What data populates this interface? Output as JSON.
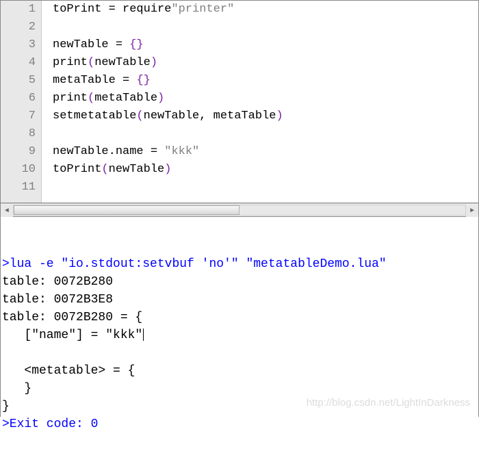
{
  "editor": {
    "lines": [
      {
        "n": "1",
        "tokens": [
          [
            "toPrint ",
            "ident"
          ],
          [
            "= ",
            "op"
          ],
          [
            "require",
            "func"
          ],
          [
            "\"printer\"",
            "string"
          ]
        ]
      },
      {
        "n": "2",
        "tokens": []
      },
      {
        "n": "3",
        "tokens": [
          [
            "newTable ",
            "ident"
          ],
          [
            "= ",
            "op"
          ],
          [
            "{}",
            "brace"
          ]
        ]
      },
      {
        "n": "4",
        "tokens": [
          [
            "print",
            "func"
          ],
          [
            "(",
            "brace"
          ],
          [
            "newTable",
            "ident"
          ],
          [
            ")",
            "brace"
          ]
        ]
      },
      {
        "n": "5",
        "tokens": [
          [
            "metaTable ",
            "ident"
          ],
          [
            "= ",
            "op"
          ],
          [
            "{}",
            "brace"
          ]
        ]
      },
      {
        "n": "6",
        "tokens": [
          [
            "print",
            "func"
          ],
          [
            "(",
            "brace"
          ],
          [
            "metaTable",
            "ident"
          ],
          [
            ")",
            "brace"
          ]
        ]
      },
      {
        "n": "7",
        "tokens": [
          [
            "setmetatable",
            "func"
          ],
          [
            "(",
            "brace"
          ],
          [
            "newTable",
            "ident"
          ],
          [
            ", ",
            "op"
          ],
          [
            "metaTable",
            "ident"
          ],
          [
            ")",
            "brace"
          ]
        ]
      },
      {
        "n": "8",
        "tokens": []
      },
      {
        "n": "9",
        "tokens": [
          [
            "newTable",
            "ident"
          ],
          [
            ".",
            "op"
          ],
          [
            "name ",
            "ident"
          ],
          [
            "= ",
            "op"
          ],
          [
            "\"kkk\"",
            "string"
          ]
        ]
      },
      {
        "n": "10",
        "tokens": [
          [
            "toPrint",
            "func"
          ],
          [
            "(",
            "brace"
          ],
          [
            "newTable",
            "ident"
          ],
          [
            ")",
            "brace"
          ]
        ]
      },
      {
        "n": "11",
        "tokens": []
      }
    ]
  },
  "output": {
    "lines": [
      {
        "text": ">lua -e \"io.stdout:setvbuf 'no'\" \"metatableDemo.lua\"",
        "cls": "out-blue"
      },
      {
        "text": "table: 0072B280",
        "cls": ""
      },
      {
        "text": "table: 0072B3E8",
        "cls": ""
      },
      {
        "text": "table: 0072B280 = {",
        "cls": ""
      },
      {
        "text": "   [\"name\"] = \"kkk\"",
        "cls": "",
        "cursor": true
      },
      {
        "text": "",
        "cls": ""
      },
      {
        "text": "   <metatable> = {",
        "cls": ""
      },
      {
        "text": "   }",
        "cls": ""
      },
      {
        "text": "}",
        "cls": ""
      },
      {
        "text": ">Exit code: 0",
        "cls": "out-blue"
      }
    ]
  },
  "watermark": "http://blog.csdn.net/LightInDarkness"
}
